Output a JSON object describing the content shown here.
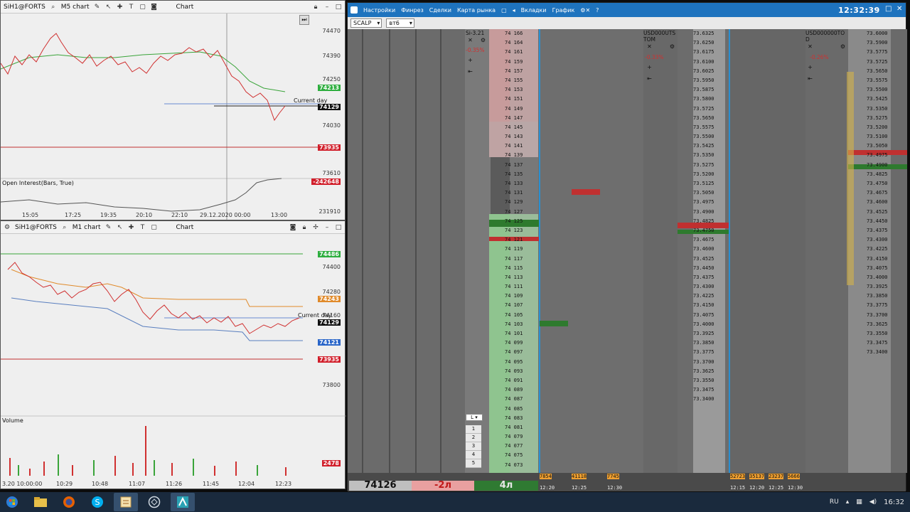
{
  "chart1": {
    "title": "SiH1@FORTS",
    "tab": "M5 chart",
    "mode": "Chart",
    "prices": [
      "74470",
      "74390",
      "74250",
      "74030",
      "73610",
      "231910"
    ],
    "badges": [
      {
        "text": "74213",
        "color": "#2eae3f"
      },
      {
        "text": "74129",
        "color": "#111111"
      },
      {
        "text": "73935",
        "color": "#d11e2a"
      },
      {
        "text": "-242648",
        "color": "#d11e2a"
      }
    ],
    "current_day": "Current day",
    "oi_label": "Open Interest(Bars, True)",
    "times": [
      "15:05",
      "17:25",
      "19:35",
      "20:10",
      "22:10",
      "29.12.2020 00:00",
      "13:00"
    ]
  },
  "chart2": {
    "title": "SiH1@FORTS",
    "tab": "M1 chart",
    "mode": "Chart",
    "prices": [
      "74400",
      "74280",
      "74160",
      "73800",
      "2478"
    ],
    "badges": [
      {
        "text": "74486",
        "color": "#2eae3f"
      },
      {
        "text": "74243",
        "color": "#e08a2a"
      },
      {
        "text": "74129",
        "color": "#111111"
      },
      {
        "text": "74121",
        "color": "#2a66c9"
      },
      {
        "text": "73935",
        "color": "#d11e2a"
      },
      {
        "text": "2478",
        "color": "#d11e2a"
      }
    ],
    "current_day": "Current day",
    "volume_label": "Volume",
    "times": [
      "3.20 10:00:00",
      "10:29",
      "10:48",
      "11:07",
      "11:26",
      "11:45",
      "12:04",
      "12:23"
    ]
  },
  "scalp": {
    "menu": [
      "Настройки",
      "Финрез",
      "Сделки",
      "Карта рынка",
      "Вкладки",
      "График"
    ],
    "clock": "12:32:39",
    "profile": "SCALP",
    "account": "вт6",
    "headers": [
      "Si-3.21",
      "USD000UTS TOM",
      "USD000000TO D"
    ],
    "pct": [
      "-0.35%",
      "-0.33%",
      "-0.26%"
    ],
    "position": "74126",
    "pnl": "-2л",
    "lots": "4л",
    "mini_values": [
      "7854",
      "41118",
      "7745",
      "52723",
      "35137",
      "23237",
      "5666"
    ],
    "mini_times": [
      "12:20",
      "12:25",
      "12:30",
      "12:15",
      "12:20",
      "12:25",
      "12:30"
    ],
    "lot_options": [
      "1",
      "2",
      "3",
      "4",
      "5"
    ],
    "ladder_prices_main": [
      "74 166",
      "74 164",
      "74 161",
      "74 159",
      "74 157",
      "74 155",
      "74 153",
      "74 151",
      "74 149",
      "74 147",
      "74 145",
      "74 143",
      "74 141",
      "74 139",
      "74 137",
      "74 135",
      "74 133",
      "74 131",
      "74 129",
      "74 127",
      "74 125",
      "74 123",
      "74 121",
      "74 119",
      "74 117",
      "74 115",
      "74 113",
      "74 111",
      "74 109",
      "74 107",
      "74 105",
      "74 103",
      "74 101",
      "74 099",
      "74 097",
      "74 095",
      "74 093",
      "74 091",
      "74 089",
      "74 087",
      "74 085",
      "74 083",
      "74 081",
      "74 079",
      "74 077",
      "74 075",
      "74 073"
    ],
    "ladder_prices_usd": [
      "73.6325",
      "73.6250",
      "73.6175",
      "73.6100",
      "73.6025",
      "73.5950",
      "73.5875",
      "73.5800",
      "73.5725",
      "73.5650",
      "73.5575",
      "73.5500",
      "73.5425",
      "73.5350",
      "73.5275",
      "73.5200",
      "73.5125",
      "73.5050",
      "73.4975",
      "73.4900",
      "73.4825",
      "73.4750",
      "73.4675",
      "73.4600",
      "73.4525",
      "73.4450",
      "73.4375",
      "73.4300",
      "73.4225",
      "73.4150",
      "73.4075",
      "73.4000",
      "73.3925",
      "73.3850",
      "73.3775",
      "73.3700",
      "73.3625",
      "73.3550",
      "73.3475",
      "73.3400"
    ],
    "ladder_prices_usd2": [
      "73.6000",
      "73.5900",
      "73.5775",
      "73.5725",
      "73.5650",
      "73.5575",
      "73.5500",
      "73.5425",
      "73.5350",
      "73.5275",
      "73.5200",
      "73.5100",
      "73.5050",
      "73.4975",
      "73.4900",
      "73.4825",
      "73.4750",
      "73.4675",
      "73.4600",
      "73.4525",
      "73.4450",
      "73.4375",
      "73.4300",
      "73.4225",
      "73.4150",
      "73.4075",
      "73.4000",
      "73.3925",
      "73.3850",
      "73.3775",
      "73.3700",
      "73.3625",
      "73.3550",
      "73.3475",
      "73.3400"
    ]
  },
  "taskbar": {
    "lang": "RU",
    "time": "16:32"
  }
}
